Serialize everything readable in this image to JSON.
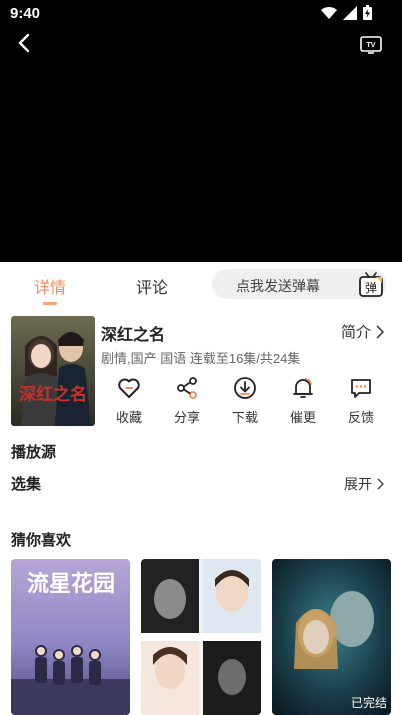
{
  "status_bar": {
    "time": "9:40"
  },
  "tabs": [
    {
      "label": "详情",
      "active": true
    },
    {
      "label": "评论",
      "active": false
    }
  ],
  "danmu": {
    "placeholder": "点我发送弹幕",
    "button_label": "弹"
  },
  "show": {
    "title": "深红之名",
    "intro_label": "简介",
    "meta": "剧情,国产 国语 连载至16集/共24集",
    "poster_text": "深红之名"
  },
  "actions": [
    {
      "label": "收藏",
      "icon": "heart-icon"
    },
    {
      "label": "分享",
      "icon": "share-icon"
    },
    {
      "label": "下载",
      "icon": "download-icon"
    },
    {
      "label": "催更",
      "icon": "bell-icon"
    },
    {
      "label": "反馈",
      "icon": "feedback-icon"
    }
  ],
  "sections": {
    "play_source": "播放源",
    "episodes": "选集",
    "expand_label": "展开",
    "guess_you_like": "猜你喜欢"
  },
  "recommendations": [
    {
      "poster_text": "流星花园",
      "badge": ""
    },
    {
      "poster_text": "",
      "badge": ""
    },
    {
      "poster_text": "",
      "badge": "已完结"
    }
  ],
  "colors": {
    "accent": "#f08a5d",
    "player_bg": "#000000",
    "muted": "#666666"
  }
}
